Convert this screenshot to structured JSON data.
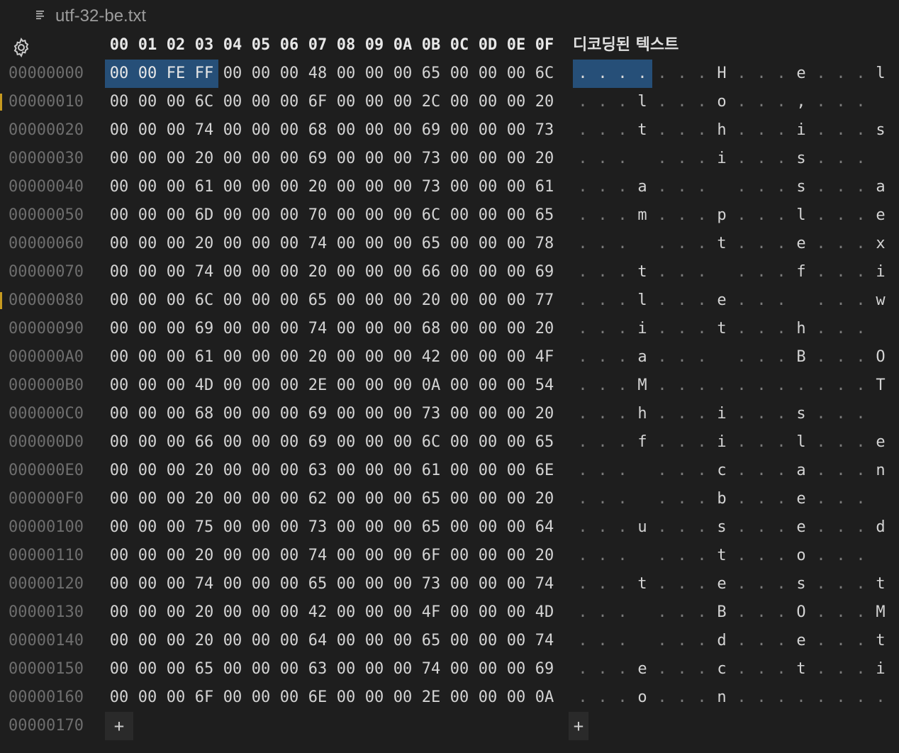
{
  "tab": {
    "title": "utf-32-be.txt"
  },
  "header": {
    "columns": [
      "00",
      "01",
      "02",
      "03",
      "04",
      "05",
      "06",
      "07",
      "08",
      "09",
      "0A",
      "0B",
      "0C",
      "0D",
      "0E",
      "0F"
    ],
    "decoded_label": "디코딩된 텍스트"
  },
  "colors": {
    "background": "#1e1e1e",
    "selection": "#264f78",
    "address": "#6e6e6e",
    "modified_marker": "#c69a20"
  },
  "selection": {
    "row": 0,
    "bytes": [
      0,
      1,
      2,
      3
    ]
  },
  "modified_rows": [
    1,
    8
  ],
  "rows": [
    {
      "addr": "00000000",
      "hex": "00 00 FE FF 00 00 00 48 00 00 00 65 00 00 00 6C"
    },
    {
      "addr": "00000010",
      "hex": "00 00 00 6C 00 00 00 6F 00 00 00 2C 00 00 00 20"
    },
    {
      "addr": "00000020",
      "hex": "00 00 00 74 00 00 00 68 00 00 00 69 00 00 00 73"
    },
    {
      "addr": "00000030",
      "hex": "00 00 00 20 00 00 00 69 00 00 00 73 00 00 00 20"
    },
    {
      "addr": "00000040",
      "hex": "00 00 00 61 00 00 00 20 00 00 00 73 00 00 00 61"
    },
    {
      "addr": "00000050",
      "hex": "00 00 00 6D 00 00 00 70 00 00 00 6C 00 00 00 65"
    },
    {
      "addr": "00000060",
      "hex": "00 00 00 20 00 00 00 74 00 00 00 65 00 00 00 78"
    },
    {
      "addr": "00000070",
      "hex": "00 00 00 74 00 00 00 20 00 00 00 66 00 00 00 69"
    },
    {
      "addr": "00000080",
      "hex": "00 00 00 6C 00 00 00 65 00 00 00 20 00 00 00 77"
    },
    {
      "addr": "00000090",
      "hex": "00 00 00 69 00 00 00 74 00 00 00 68 00 00 00 20"
    },
    {
      "addr": "000000A0",
      "hex": "00 00 00 61 00 00 00 20 00 00 00 42 00 00 00 4F"
    },
    {
      "addr": "000000B0",
      "hex": "00 00 00 4D 00 00 00 2E 00 00 00 0A 00 00 00 54"
    },
    {
      "addr": "000000C0",
      "hex": "00 00 00 68 00 00 00 69 00 00 00 73 00 00 00 20"
    },
    {
      "addr": "000000D0",
      "hex": "00 00 00 66 00 00 00 69 00 00 00 6C 00 00 00 65"
    },
    {
      "addr": "000000E0",
      "hex": "00 00 00 20 00 00 00 63 00 00 00 61 00 00 00 6E"
    },
    {
      "addr": "000000F0",
      "hex": "00 00 00 20 00 00 00 62 00 00 00 65 00 00 00 20"
    },
    {
      "addr": "00000100",
      "hex": "00 00 00 75 00 00 00 73 00 00 00 65 00 00 00 64"
    },
    {
      "addr": "00000110",
      "hex": "00 00 00 20 00 00 00 74 00 00 00 6F 00 00 00 20"
    },
    {
      "addr": "00000120",
      "hex": "00 00 00 74 00 00 00 65 00 00 00 73 00 00 00 74"
    },
    {
      "addr": "00000130",
      "hex": "00 00 00 20 00 00 00 42 00 00 00 4F 00 00 00 4D"
    },
    {
      "addr": "00000140",
      "hex": "00 00 00 20 00 00 00 64 00 00 00 65 00 00 00 74"
    },
    {
      "addr": "00000150",
      "hex": "00 00 00 65 00 00 00 63 00 00 00 74 00 00 00 69"
    },
    {
      "addr": "00000160",
      "hex": "00 00 00 6F 00 00 00 6E 00 00 00 2E 00 00 00 0A"
    }
  ],
  "last_row": {
    "addr": "00000170",
    "add_hex_label": "+",
    "add_text_label": "+"
  }
}
